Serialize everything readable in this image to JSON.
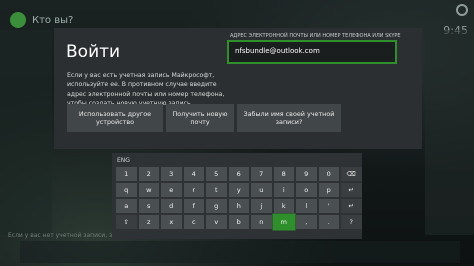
{
  "background": {
    "title": "Кто вы?",
    "clock": "9:45",
    "small_text": "Если у вас нет учетной записи, зарегистрируйте"
  },
  "dialog": {
    "title": "Войти",
    "description": "Если у вас есть учетная запись Майкрософт, используйте ее. В противном случае введите адрес электронной почты или номер телефона, чтобы создать новую учетную запись.",
    "field_label": "АДРЕС ЭЛЕКТРОННОЙ ПОЧТЫ ИЛИ НОМЕР ТЕЛЕФОНА ИЛИ SKYPE",
    "field_value": "nfsbundle@outlook.com",
    "buttons": [
      "Использовать другое устройство",
      "Получить новую почту",
      "Забыли имя своей учетной записи?"
    ]
  },
  "keyboard": {
    "language": "ENG",
    "rows": [
      [
        "1",
        "2",
        "3",
        "4",
        "5",
        "6",
        "7",
        "8",
        "9",
        "0",
        "⌫"
      ],
      [
        "q",
        "w",
        "e",
        "r",
        "t",
        "y",
        "u",
        "i",
        "o",
        "p",
        "↵"
      ],
      [
        "a",
        "s",
        "d",
        "f",
        "g",
        "h",
        "j",
        "k",
        "l",
        "'",
        "↵"
      ],
      [
        "⇧",
        "z",
        "x",
        "c",
        "v",
        "b",
        "n",
        "m",
        ",",
        ".",
        "?"
      ],
      [
        "&123",
        "@",
        "⬤",
        "←",
        "→",
        "@"
      ]
    ],
    "focused_key": "m"
  }
}
